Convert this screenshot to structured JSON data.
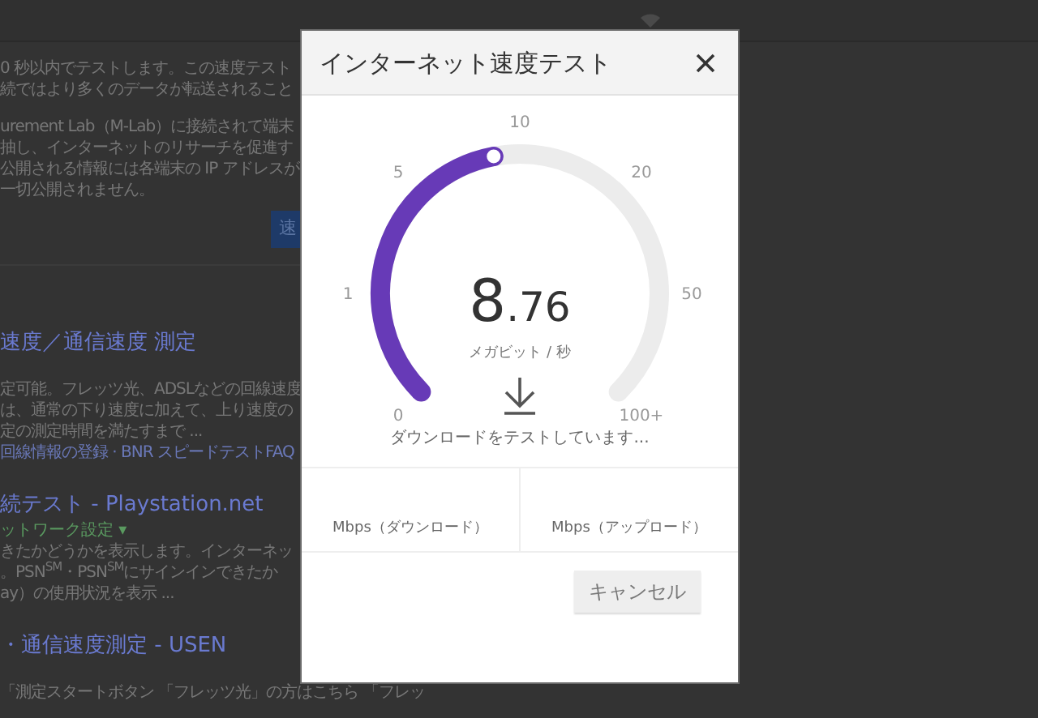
{
  "background_page": {
    "blocks": [
      {
        "kind": "text",
        "lines": [
          "0 秒以内でテストします。この速度テスト",
          "続ではより多くのデータが転送されること"
        ]
      },
      {
        "kind": "text",
        "lines": [
          "urement Lab（M-Lab）に接続されて端末",
          "抽し、インターネットのリサーチを促進す",
          "公開される情報には各端末の IP アドレスが",
          "一切公開されません。"
        ]
      },
      {
        "kind": "button",
        "label": "速"
      },
      {
        "kind": "result",
        "title": "速度／通信速度 測定",
        "lines": [
          "定可能。フレッツ光、ADSLなどの回線速度",
          "は、通常の下り速度に加えて、上り速度の",
          "定の測定時間を満たすまで ..."
        ],
        "links": "回線情報の登録 · BNR スピードテストFAQ"
      },
      {
        "kind": "result",
        "title": "続テスト - Playstation.net",
        "breadcrumb": "ットワーク設定 ▾",
        "lines": [
          "きたかどうかを表示します。インターネッ",
          "。PSN$^{SM}$・PSN$^{SM}$にサインインできたか",
          "ay）の使用状況を表示 ..."
        ]
      },
      {
        "kind": "result",
        "title": "・通信速度測定 - USEN",
        "lines": [
          "「測定スタートボタン 「フレッツ光」の方はこちら 「フレッ"
        ]
      }
    ]
  },
  "modal": {
    "title": "インターネット速度テスト",
    "gauge": {
      "level": 0.46,
      "ticks": [
        "0",
        "1",
        "5",
        "10",
        "20",
        "50",
        "100+"
      ],
      "reading_whole": "8",
      "reading_fraction": ".76",
      "unit": "メガビット / 秒"
    },
    "status": "ダウンロードをテストしています...",
    "results": [
      {
        "label": "Mbps（ダウンロード）"
      },
      {
        "label": "Mbps（アップロード）"
      }
    ],
    "buttons": [
      {
        "label": "キャンセル"
      }
    ]
  }
}
